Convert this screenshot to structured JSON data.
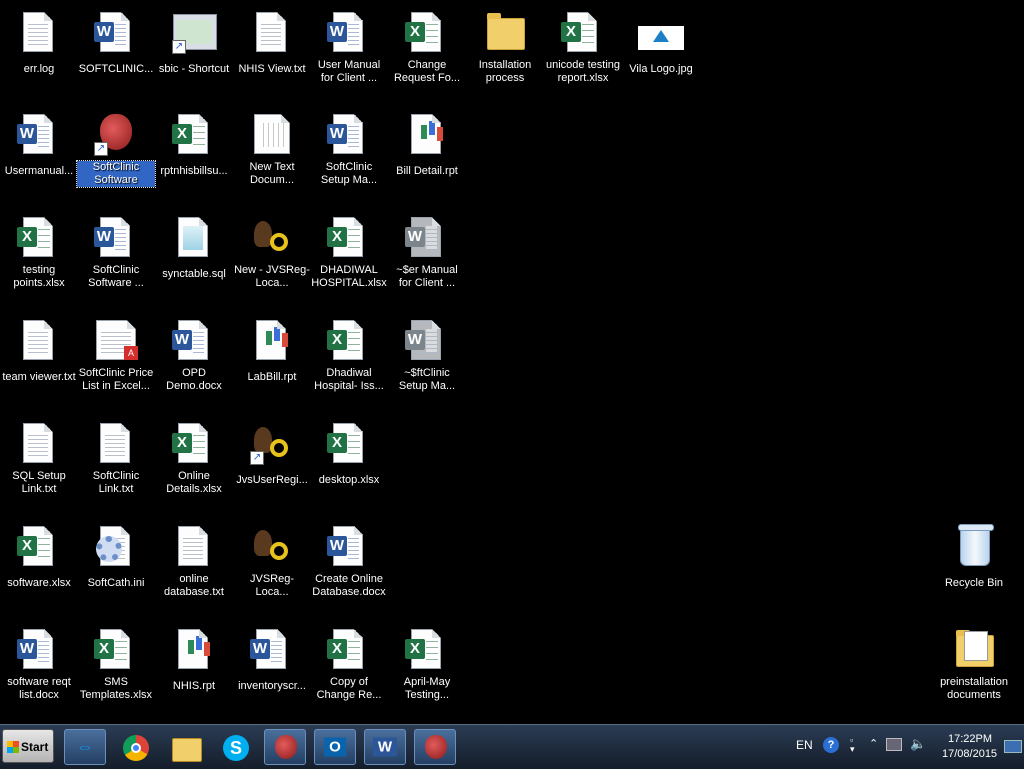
{
  "desktop": {
    "icons": [
      {
        "label": "err.log"
      },
      {
        "label": "SOFTCLINIC..."
      },
      {
        "label": "sbic - Shortcut"
      },
      {
        "label": "NHIS View.txt"
      },
      {
        "label": "User Manual for Client ..."
      },
      {
        "label": "Change Request Fo..."
      },
      {
        "label": "Installation process"
      },
      {
        "label": "unicode testing report.xlsx"
      },
      {
        "label": "Vila Logo.jpg"
      },
      {
        "label": "Usermanual..."
      },
      {
        "label": "SoftClinic Software"
      },
      {
        "label": "rptnhisbillsu..."
      },
      {
        "label": "New Text Docum..."
      },
      {
        "label": "SoftClinic Setup Ma..."
      },
      {
        "label": "Bill Detail.rpt"
      },
      {
        "label": "testing points.xlsx"
      },
      {
        "label": "SoftClinic Software ..."
      },
      {
        "label": "synctable.sql"
      },
      {
        "label": "New - JVSReg-Loca..."
      },
      {
        "label": "DHADIWAL HOSPITAL.xlsx"
      },
      {
        "label": "~$er Manual for Client ..."
      },
      {
        "label": "team viewer.txt"
      },
      {
        "label": "SoftClinic Price List in Excel..."
      },
      {
        "label": "OPD Demo.docx"
      },
      {
        "label": "LabBill.rpt"
      },
      {
        "label": "Dhadiwal Hospital- Iss..."
      },
      {
        "label": "~$ftClinic Setup Ma..."
      },
      {
        "label": "SQL Setup Link.txt"
      },
      {
        "label": "SoftClinic Link.txt"
      },
      {
        "label": "Online Details.xlsx"
      },
      {
        "label": "JvsUserRegi..."
      },
      {
        "label": "desktop.xlsx"
      },
      {
        "label": "software.xlsx"
      },
      {
        "label": "SoftCath.ini"
      },
      {
        "label": "online database.txt"
      },
      {
        "label": "JVSReg-Loca..."
      },
      {
        "label": "Create Online Database.docx"
      },
      {
        "label": "software reqt list.docx"
      },
      {
        "label": "SMS Templates.xlsx"
      },
      {
        "label": "NHIS.rpt"
      },
      {
        "label": "inventoryscr..."
      },
      {
        "label": "Copy of Change Re..."
      },
      {
        "label": "April-May Testing..."
      },
      {
        "label": "Recycle Bin"
      },
      {
        "label": "preinstallation documents"
      }
    ]
  },
  "taskbar": {
    "start_label": "Start",
    "language": "EN",
    "time": "17:22PM",
    "date": "17/08/2015"
  }
}
